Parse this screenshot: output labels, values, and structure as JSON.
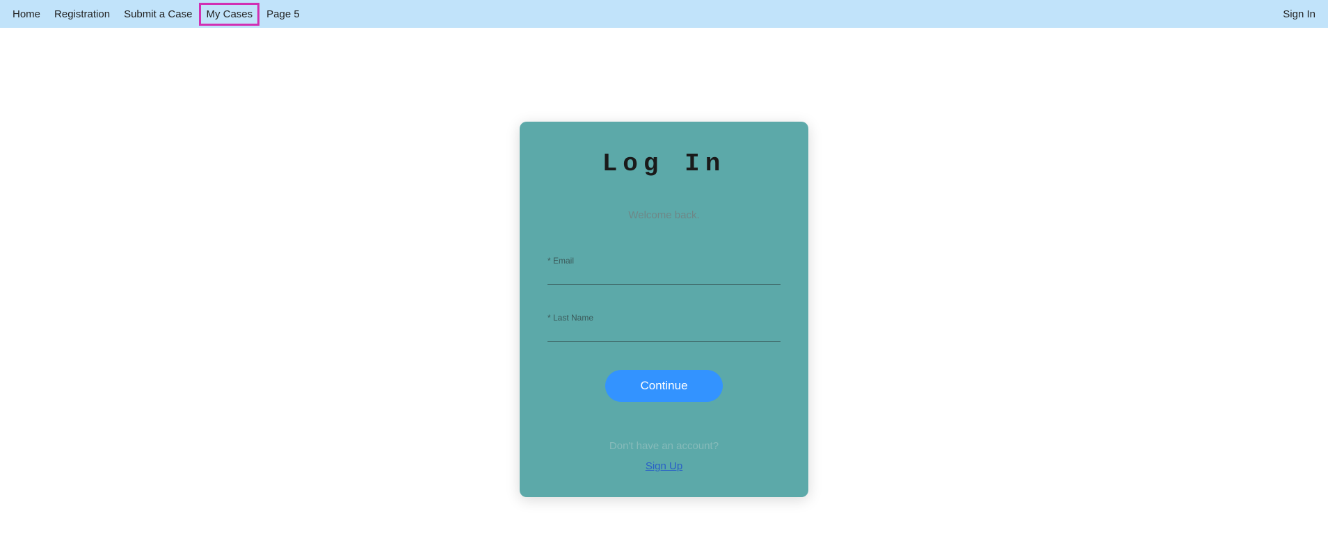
{
  "nav": {
    "items": [
      {
        "label": "Home"
      },
      {
        "label": "Registration"
      },
      {
        "label": "Submit a Case"
      },
      {
        "label": "My Cases"
      },
      {
        "label": "Page 5"
      }
    ],
    "highlighted_index": 3,
    "sign_in_label": "Sign In"
  },
  "login": {
    "title": "Log In",
    "subtitle": "Welcome back.",
    "email_label": "* Email",
    "lastname_label": "* Last Name",
    "continue_label": "Continue",
    "signup_prompt": "Don't have an account?",
    "signup_link": "Sign Up"
  }
}
